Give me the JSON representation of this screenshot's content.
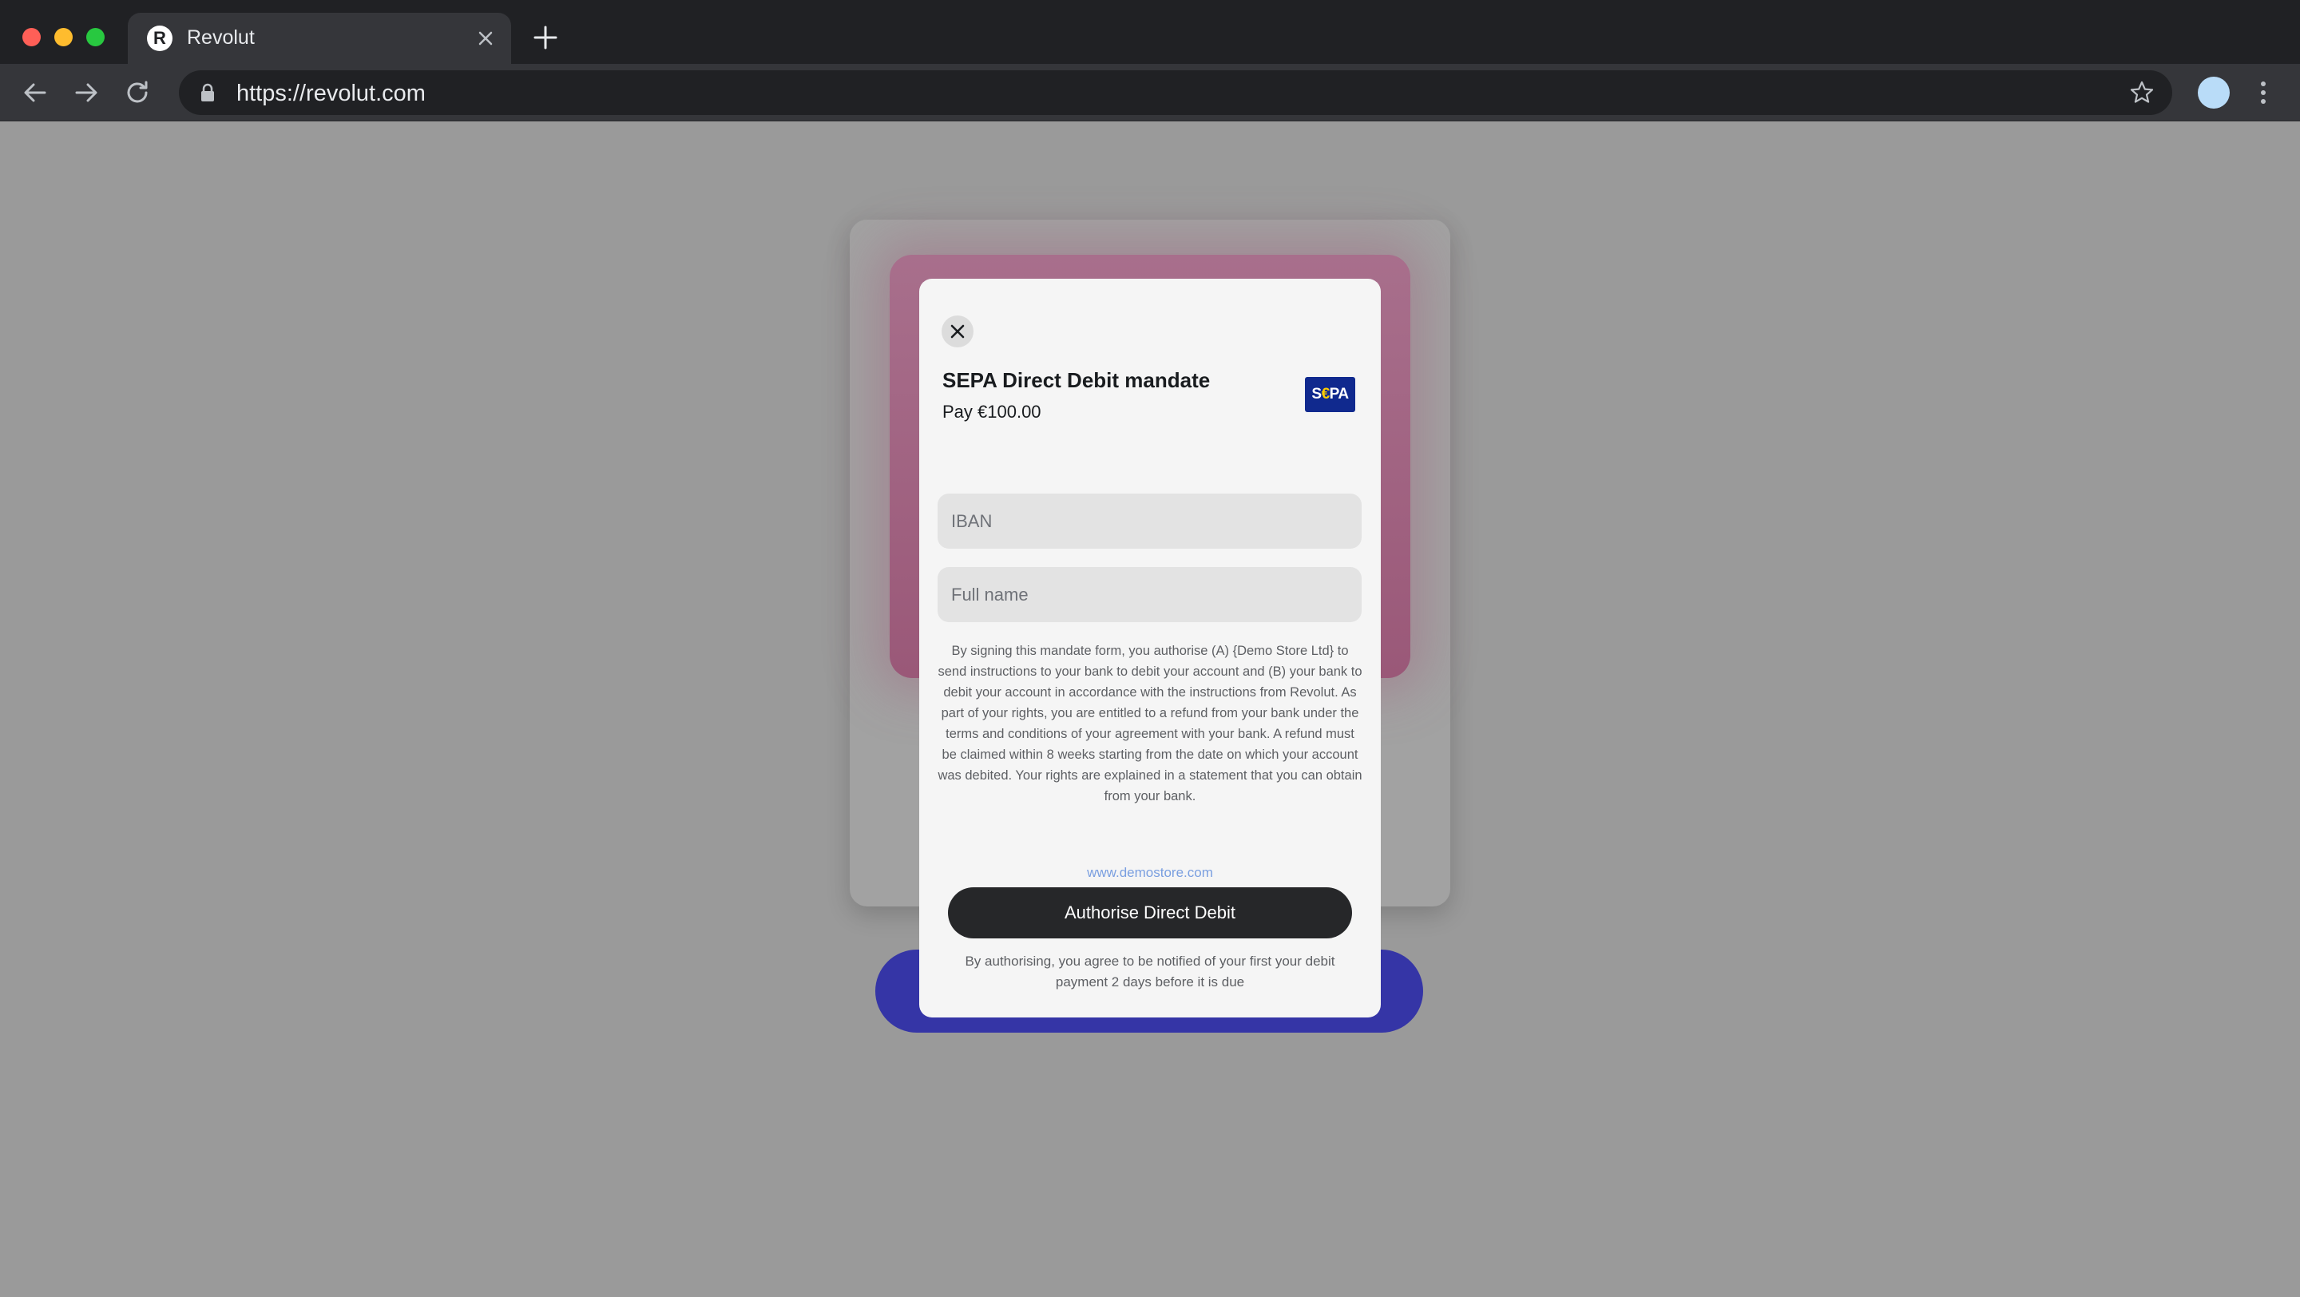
{
  "browser": {
    "tab": {
      "title": "Revolut",
      "favicon_letter": "R"
    },
    "url": "https://revolut.com",
    "icons": {
      "back": "arrow-left-icon",
      "forward": "arrow-right-icon",
      "reload": "reload-icon",
      "lock": "lock-icon",
      "bookmark": "star-icon",
      "menu": "kebab-menu-icon"
    }
  },
  "modal": {
    "title": "SEPA Direct Debit mandate",
    "subtitle": "Pay €100.00",
    "logo": {
      "prefix": "S",
      "euro": "€",
      "suffix": "PA"
    },
    "iban_placeholder": "IBAN",
    "name_placeholder": "Full name",
    "legal_text": "By signing this mandate form, you authorise (A) {Demo Store Ltd} to send instructions to your bank to debit your account and (B) your bank to debit your account in accordance with the instructions from Revolut. As part of your rights, you are entitled to a refund from your bank under the terms and conditions of your agreement with your bank. A refund must be claimed within 8 weeks starting from the date on which your account was debited. Your rights are explained in a statement that you can obtain from your bank.",
    "merchant_link": "www.demostore.com",
    "button_label": "Authorise Direct Debit",
    "footnote": "By authorising, you agree to be notified of your first your debit payment 2 days before it is due"
  },
  "colors": {
    "sepa_blue": "#10298e",
    "button_dark": "#262729",
    "backdrop_pink": "#9a5878",
    "backdrop_pill": "#3535a6"
  }
}
